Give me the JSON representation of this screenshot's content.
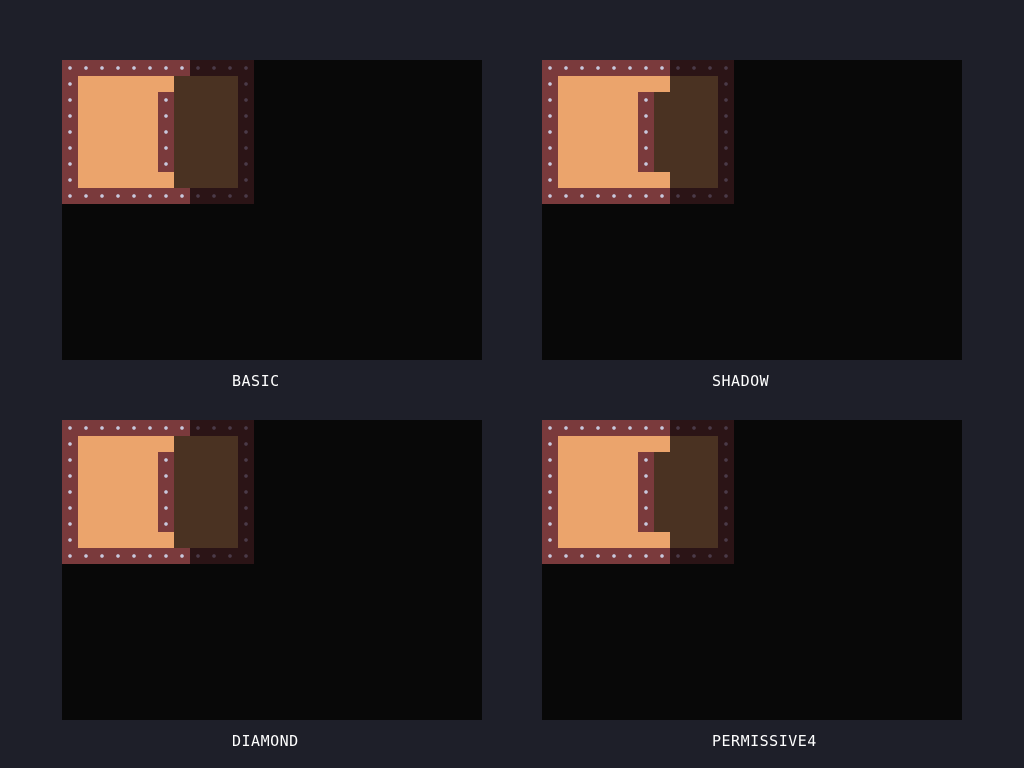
{
  "colors": {
    "background": "#1e1f29",
    "viewport": "#080808",
    "wall_lit": "#7a3a3c",
    "wall_dim": "#2b1416",
    "floor_lit": "#eba46c",
    "floor_dim": "#4a3222",
    "caption_text": "#ffffff"
  },
  "panels": [
    {
      "caption": "BASIC"
    },
    {
      "caption": "SHADOW"
    },
    {
      "caption": "DIAMOND"
    },
    {
      "caption": "PERMISSIVE4"
    }
  ]
}
